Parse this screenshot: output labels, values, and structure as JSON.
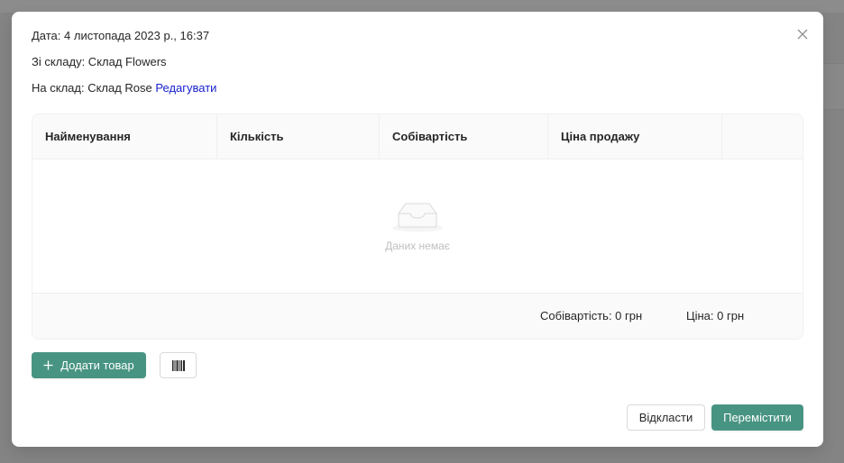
{
  "modal": {
    "date_line": "Дата: 4 листопада 2023 р., 16:37",
    "from_line": "Зі складу: Склад Flowers",
    "to_line": "На склад: Склад Rose",
    "edit_link": "Редагувати"
  },
  "table": {
    "columns": [
      "Найменування",
      "Кількість",
      "Собівартість",
      "Ціна продажу",
      ""
    ],
    "empty_text": "Даних немає",
    "footer": {
      "cost_total": "Собівартість: 0 грн",
      "price_total": "Ціна: 0 грн"
    }
  },
  "actions": {
    "add_label": "Додати товар",
    "barcode_icon": "barcode-icon",
    "defer_label": "Відкласти",
    "move_label": "Перемістити"
  },
  "colors": {
    "primary": "#489482",
    "link": "#1a22cc",
    "mask": "rgba(0,0,0,0.45)"
  }
}
